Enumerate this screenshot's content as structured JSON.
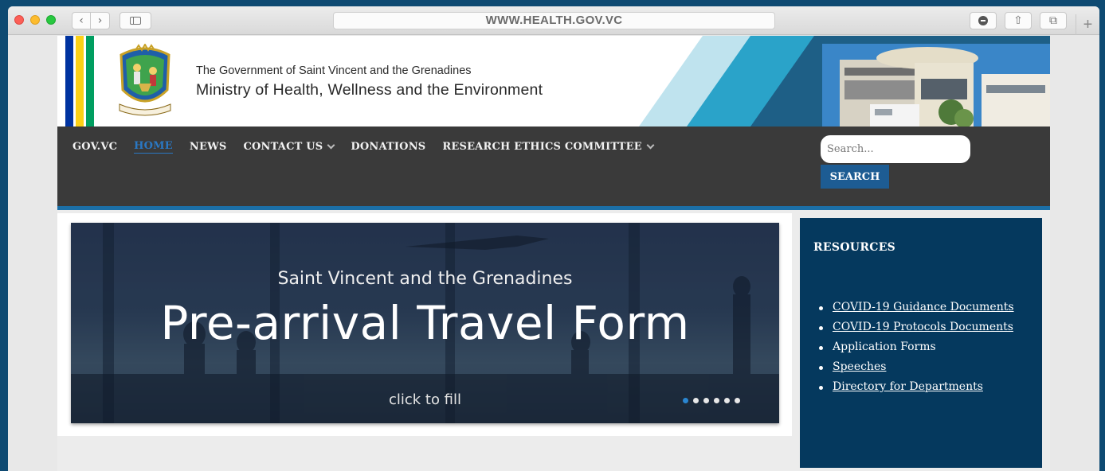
{
  "browser": {
    "url": "WWW.HEALTH.GOV.VC",
    "back_icon": "‹",
    "forward_icon": "›",
    "new_tab_icon": "+",
    "share_icon": "⇧",
    "tabs_icon": "⧉"
  },
  "header": {
    "government_name": "The Government of Saint Vincent and the Grenadines",
    "ministry_name": "Ministry of Health, Wellness and the Environment",
    "flag_colors": [
      "#0033a0",
      "#fcd116",
      "#009e60"
    ]
  },
  "nav": {
    "items": [
      {
        "label": "GOV.VC",
        "dropdown": false,
        "active": false
      },
      {
        "label": "HOME",
        "dropdown": false,
        "active": true
      },
      {
        "label": "NEWS",
        "dropdown": false,
        "active": false
      },
      {
        "label": "CONTACT US",
        "dropdown": true,
        "active": false
      },
      {
        "label": "DONATIONS",
        "dropdown": false,
        "active": false
      },
      {
        "label": "RESEARCH ETHICS COMMITTEE",
        "dropdown": true,
        "active": false
      }
    ],
    "search_placeholder": "Search...",
    "search_button": "SEARCH"
  },
  "slider": {
    "subtitle": "Saint Vincent and the Grenadines",
    "title": "Pre-arrival Travel Form",
    "cta": "click to fill",
    "slide_count": 6,
    "active_slide": 1
  },
  "resources": {
    "title": "RESOURCES",
    "items": [
      {
        "label": "COVID-19 Guidance Documents",
        "link": true
      },
      {
        "label": "COVID-19 Protocols Documents",
        "link": true
      },
      {
        "label": "Application Forms",
        "link": false
      },
      {
        "label": "Speeches",
        "link": true
      },
      {
        "label": "Directory for Departments",
        "link": true
      }
    ]
  },
  "colors": {
    "nav_bg": "#3a3a3a",
    "accent": "#1b6fa7",
    "sidebar_bg": "#05395e",
    "active_nav": "#2a78c4"
  }
}
